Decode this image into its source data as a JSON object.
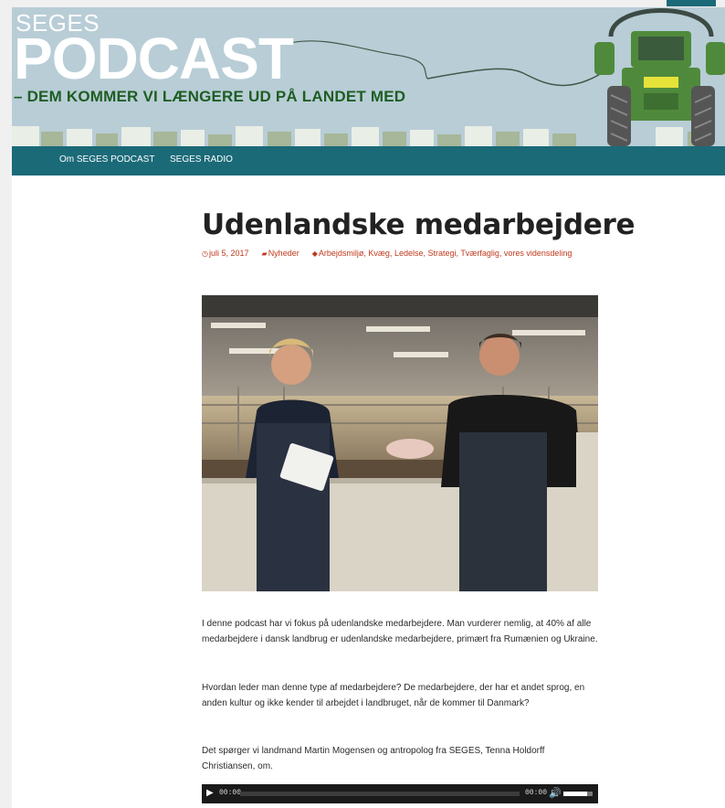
{
  "banner": {
    "brand_small": "SEGES",
    "brand_big": "PODCAST",
    "tagline": "– DEM KOMMER VI LÆNGERE UD PÅ LANDET MED"
  },
  "nav": {
    "items": [
      {
        "label": "Om SEGES PODCAST"
      },
      {
        "label": "SEGES RADIO"
      }
    ]
  },
  "article": {
    "title": "Udenlandske medarbejdere",
    "date": "juli 5, 2017",
    "category": "Nyheder",
    "tags": [
      "Arbejdsmiljø",
      "Kvæg",
      "Ledelse",
      "Strategi",
      "Tværfaglig",
      "vores vidensdeling"
    ],
    "paragraphs": [
      "I denne podcast har vi fokus på udenlandske medarbejdere. Man vurderer nemlig, at 40% af alle medarbejdere i dansk landbrug er udenlandske medarbejdere, primært fra Rumænien og Ukraine.",
      "Hvordan leder man denne type af medarbejdere? De medarbejdere, der har et andet sprog, en anden kultur og ikke kender til arbejdet i landbruget, når de kommer til Danmark?",
      "Det spørger vi landmand Martin Mogensen og antropolog fra SEGES, Tenna Holdorff Christiansen, om."
    ]
  },
  "player": {
    "current_time": "00:00",
    "duration": "00:00",
    "volume": 0.8
  },
  "colors": {
    "nav_bg": "#1b6a78",
    "meta_link": "#bf3a1e",
    "tagline": "#1e5d22",
    "tractor": "#4f8a3c"
  }
}
